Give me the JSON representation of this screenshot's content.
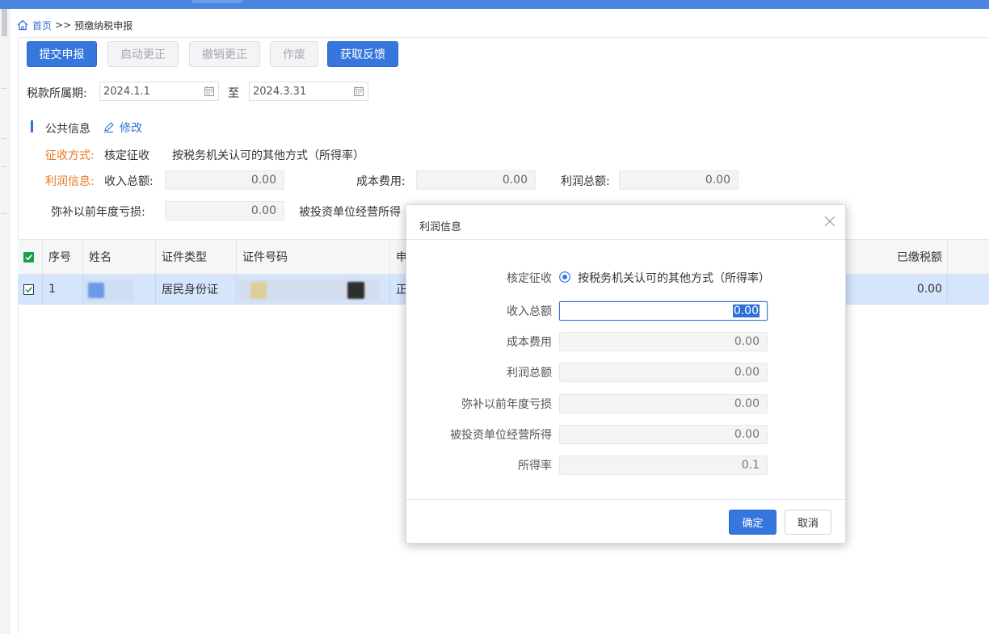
{
  "breadcrumb": {
    "home": "首页",
    "separator": ">>",
    "current": "预缴纳税申报"
  },
  "toolbar": {
    "submit": "提交申报",
    "start_correction": "启动更正",
    "cancel_correction": "撤销更正",
    "void": "作废",
    "get_feedback": "获取反馈"
  },
  "period": {
    "label": "税款所属期:",
    "start": "2024.1.1",
    "to": "至",
    "end": "2024.3.31"
  },
  "public_info": {
    "title": "公共信息",
    "edit": "修改",
    "collection_label": "征收方式:",
    "collection_value": "核定征收",
    "collection_method": "按税务机关认可的其他方式（所得率）",
    "profit_label": "利润信息:",
    "income_label": "收入总额:",
    "income_value": "0.00",
    "cost_label": "成本费用:",
    "cost_value": "0.00",
    "profit_total_label": "利润总额:",
    "profit_total_value": "0.00",
    "loss_label": "弥补以前年度亏损:",
    "loss_value": "0.00",
    "investee_label": "被投资单位经营所得"
  },
  "table": {
    "headers": {
      "seq": "序号",
      "name": "姓名",
      "id_type": "证件类型",
      "id_number": "证件号码",
      "partial": "申",
      "paid": "已缴税额"
    },
    "rows": [
      {
        "seq": "1",
        "id_type": "居民身份证",
        "partial": "正",
        "paid": "0.00"
      }
    ]
  },
  "modal": {
    "title": "利润信息",
    "method_label": "核定征收",
    "method_option": "按税务机关认可的其他方式（所得率）",
    "fields": [
      {
        "label": "收入总额",
        "value": "0.00"
      },
      {
        "label": "成本费用",
        "value": "0.00"
      },
      {
        "label": "利润总额",
        "value": "0.00"
      },
      {
        "label": "弥补以前年度亏损",
        "value": "0.00"
      },
      {
        "label": "被投资单位经营所得",
        "value": "0.00"
      },
      {
        "label": "所得率",
        "value": "0.1"
      }
    ],
    "ok": "确定",
    "cancel": "取消"
  },
  "colors": {
    "primary": "#3677dd",
    "accent_orange": "#e8761f",
    "link": "#2f6fd8",
    "row_selected": "#d5e5fb"
  }
}
